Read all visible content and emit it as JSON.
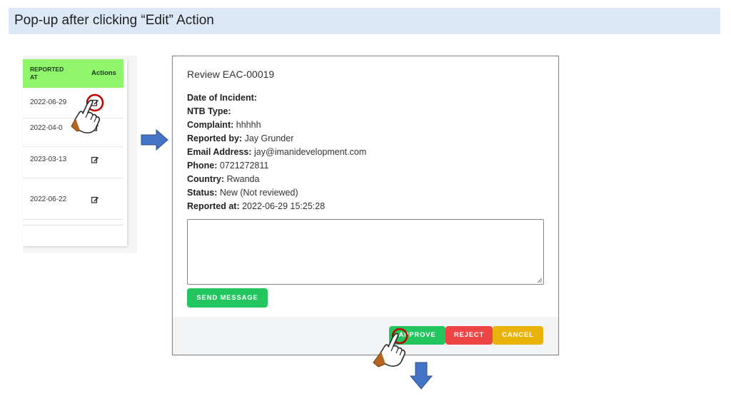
{
  "slide": {
    "title": "Pop-up after clicking “Edit” Action"
  },
  "table": {
    "header_reported": "REPORTED\nAT",
    "header_actions": "Actions",
    "rows": [
      {
        "date": "2022-06-29"
      },
      {
        "date": "2022-04-0"
      },
      {
        "date": "2023-03-13"
      },
      {
        "date": "2022-06-22"
      }
    ]
  },
  "modal": {
    "title": "Review EAC-00019",
    "details": {
      "date_label": "Date of Incident:",
      "ntb_label": "NTB Type:",
      "complaint_label": "Complaint:",
      "complaint_value": "hhhhh",
      "reported_by_label": "Reported by:",
      "reported_by_value": "Jay Grunder",
      "email_label": "Email Address:",
      "email_value": "jay@imanidevelopment.com",
      "phone_label": "Phone:",
      "phone_value": "0721272811",
      "country_label": "Country:",
      "country_value": "Rwanda",
      "status_label": "Status:",
      "status_value": "New (Not reviewed)",
      "reported_at_label": "Reported at:",
      "reported_at_value": "2022-06-29 15:25:28"
    },
    "message_value": "",
    "send_label": "SEND MESSAGE",
    "approve_label": "APPROVE",
    "reject_label": "REJECT",
    "cancel_label": "CANCEL"
  },
  "colors": {
    "header_green": "#8ff56a",
    "approve": "#22c55e",
    "reject": "#ef4444",
    "cancel": "#eab308",
    "arrow": "#4472c4",
    "highlight_circle": "#c00000"
  },
  "icons": [
    "edit-icon",
    "pointing-hand-icon",
    "right-arrow-icon",
    "down-arrow-icon",
    "resize-grip-icon"
  ]
}
